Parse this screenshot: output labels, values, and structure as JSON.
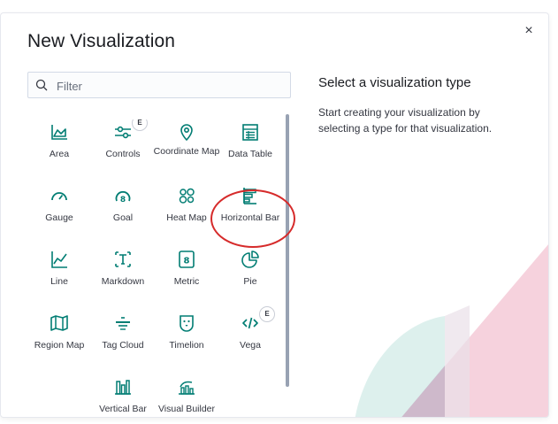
{
  "modal": {
    "title": "New Visualization",
    "close_glyph": "×"
  },
  "search": {
    "placeholder": "Filter",
    "icon": "search-icon"
  },
  "sidebar": {
    "heading": "Select a visualization type",
    "description": "Start creating your visualization by selecting a type for that visualization."
  },
  "tiles": [
    {
      "label": "Area",
      "icon": "area-chart-icon"
    },
    {
      "label": "Controls",
      "icon": "controls-icon",
      "badge": "E"
    },
    {
      "label": "Coordinate Map",
      "icon": "map-pin-icon"
    },
    {
      "label": "Data Table",
      "icon": "data-table-icon"
    },
    {
      "label": "Gauge",
      "icon": "gauge-icon"
    },
    {
      "label": "Goal",
      "icon": "goal-icon"
    },
    {
      "label": "Heat Map",
      "icon": "heat-map-icon"
    },
    {
      "label": "Horizontal Bar",
      "icon": "horizontal-bar-icon"
    },
    {
      "label": "Line",
      "icon": "line-chart-icon"
    },
    {
      "label": "Markdown",
      "icon": "markdown-icon"
    },
    {
      "label": "Metric",
      "icon": "metric-icon"
    },
    {
      "label": "Pie",
      "icon": "pie-chart-icon"
    },
    {
      "label": "Region Map",
      "icon": "region-map-icon"
    },
    {
      "label": "Tag Cloud",
      "icon": "tag-cloud-icon"
    },
    {
      "label": "Timelion",
      "icon": "timelion-icon"
    },
    {
      "label": "Vega",
      "icon": "vega-icon",
      "badge": "E"
    },
    {
      "label": "Vertical Bar",
      "icon": "vertical-bar-icon"
    },
    {
      "label": "Visual Builder",
      "icon": "visual-builder-icon"
    }
  ],
  "colors": {
    "accent": "#017d73",
    "annotation": "#d62b2b",
    "deco_pink": "#f3c3d2",
    "deco_teal": "#bfe3df"
  }
}
